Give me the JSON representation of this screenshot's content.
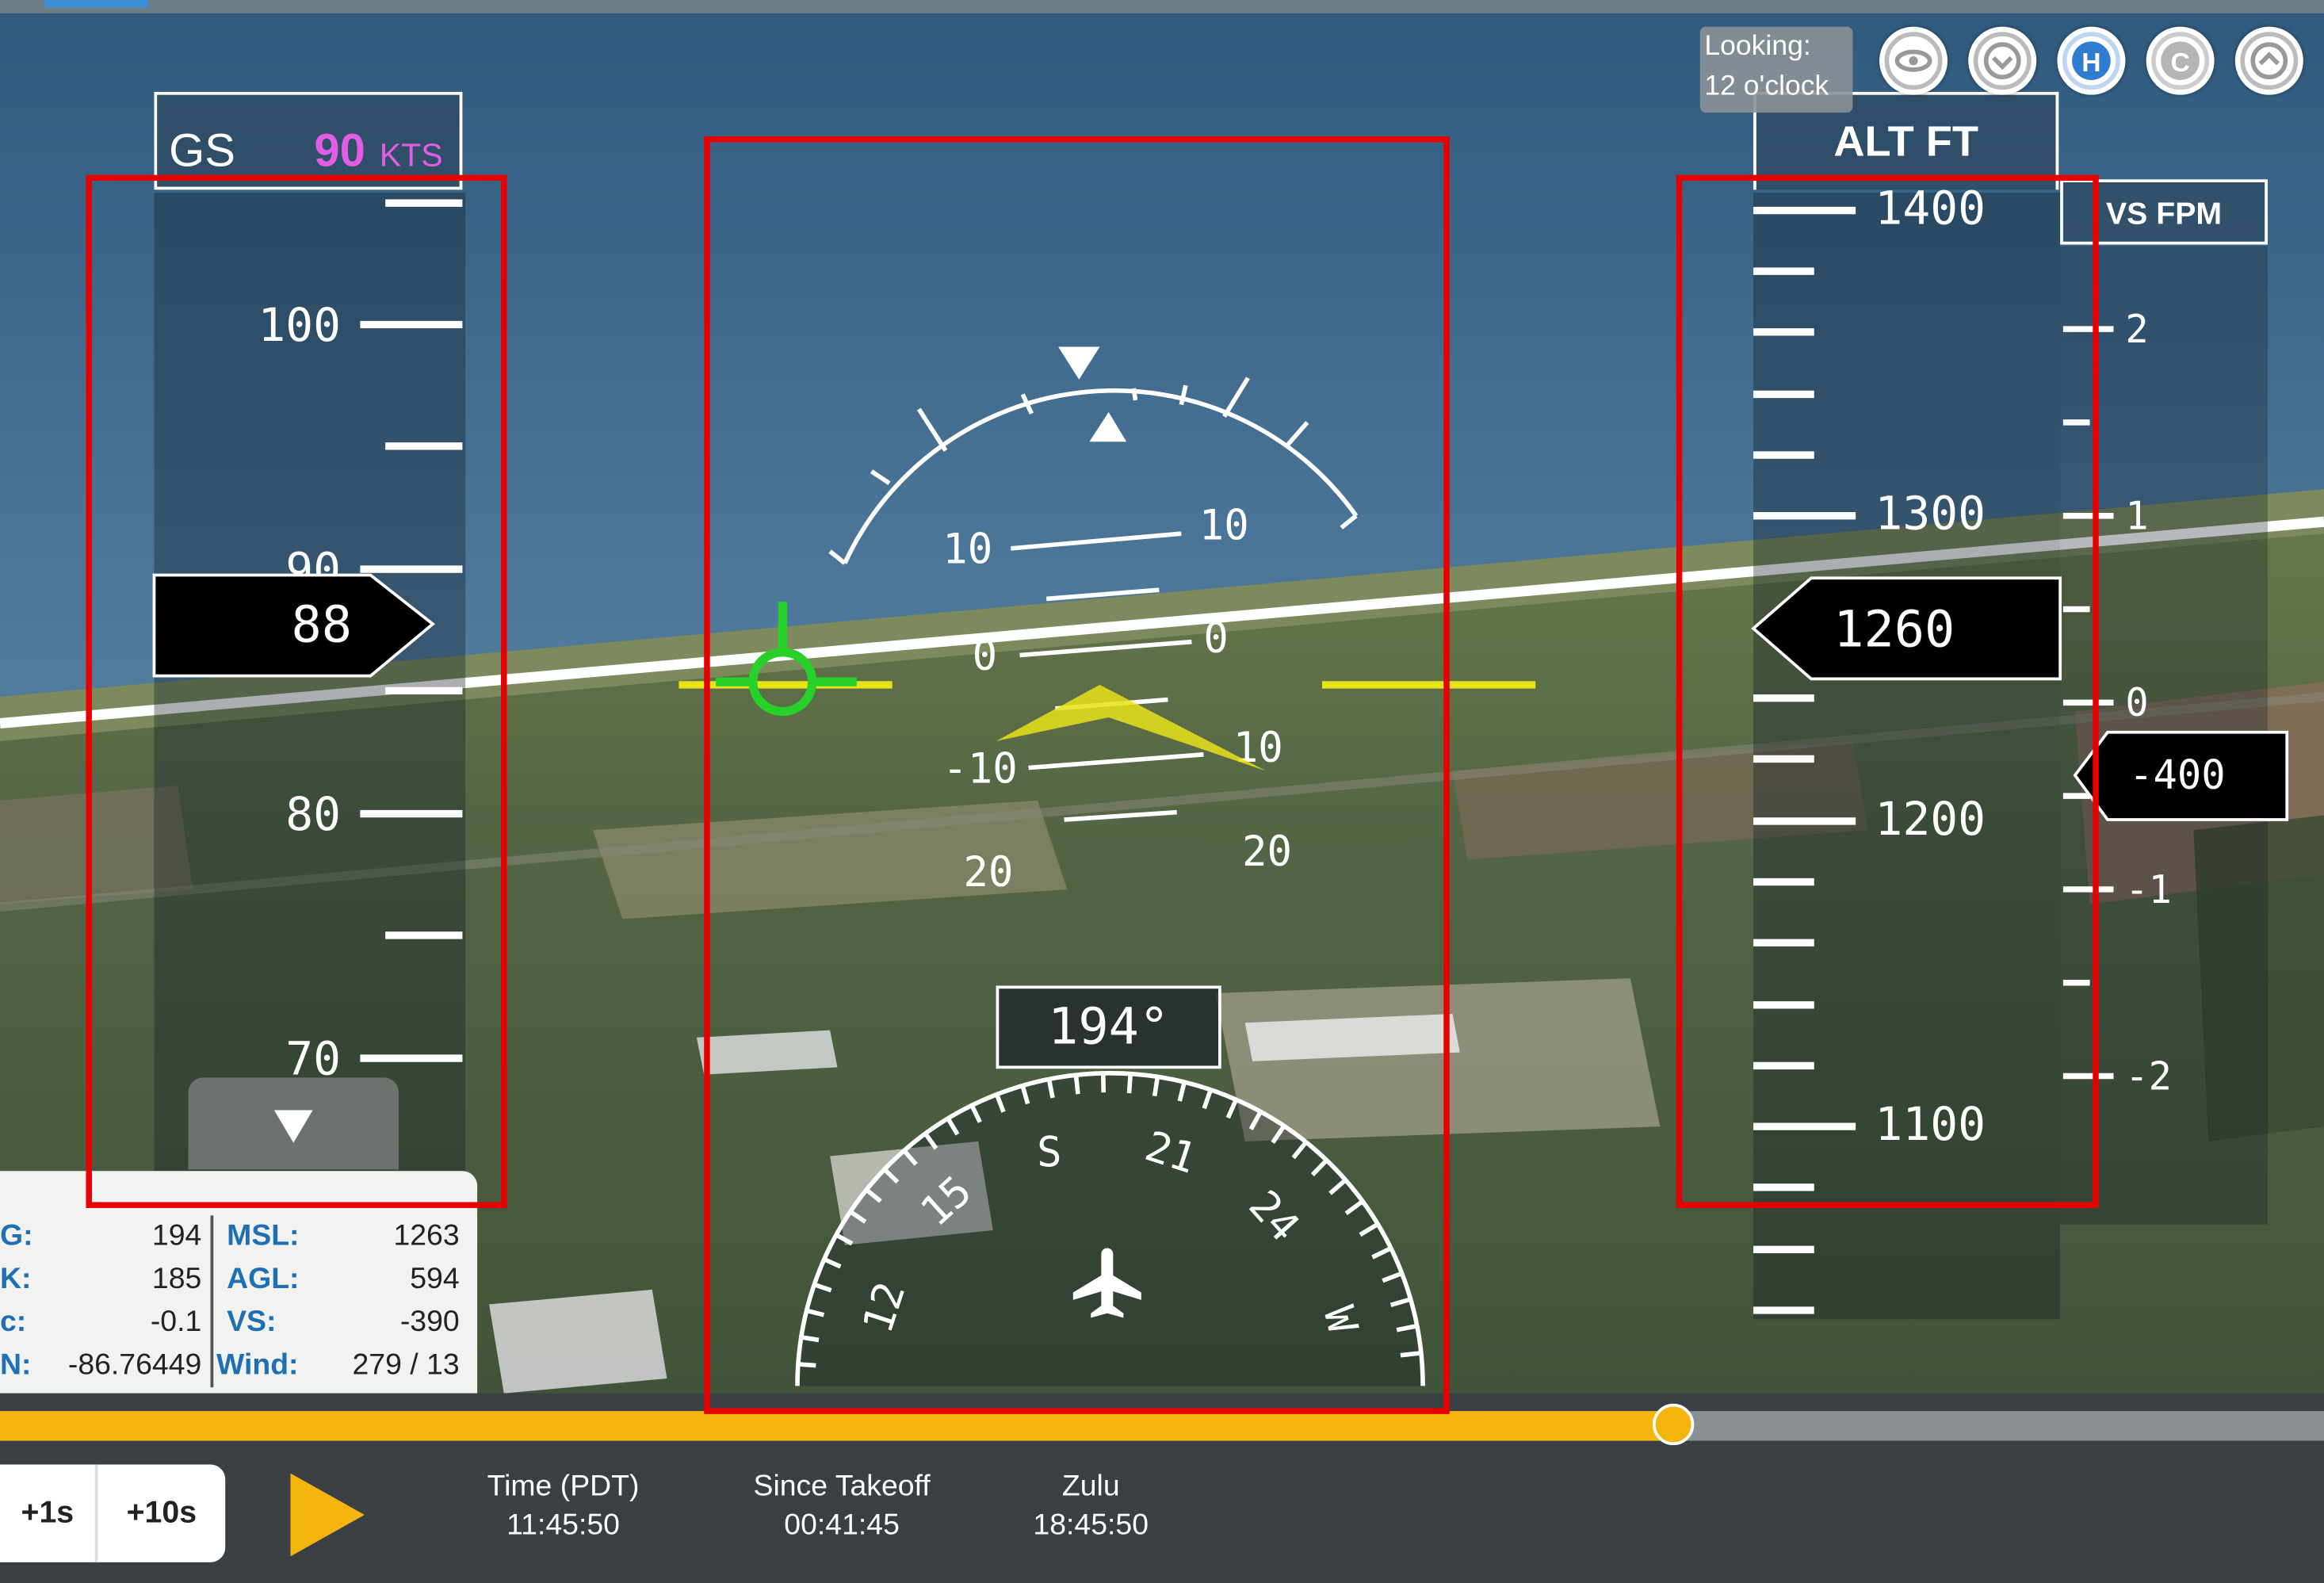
{
  "speed_tape": {
    "header_label": "GS",
    "header_value": "90",
    "header_unit": "KTS",
    "labels": [
      "100",
      "90",
      "80",
      "70"
    ],
    "current": "88"
  },
  "altitude_tape": {
    "header": "ALT FT",
    "labels": [
      "1400",
      "1300",
      "1200",
      "1100"
    ],
    "current": "1260"
  },
  "vs_tape": {
    "header": "VS FPM",
    "labels": [
      "2",
      "1",
      "0",
      "-1",
      "-2"
    ],
    "current": "-400"
  },
  "attitude": {
    "pitch_labels": [
      "10",
      "10",
      "0",
      "0",
      "-10",
      "10",
      "20",
      "20"
    ]
  },
  "heading": {
    "readout": "194°",
    "compass_labels": [
      "S",
      "21",
      "24",
      "W",
      "15",
      "12"
    ]
  },
  "looking": {
    "line1": "Looking:",
    "line2": "12 o'clock"
  },
  "view_buttons": [
    "eye-icon",
    "chevron-down-circle-icon",
    "H",
    "C",
    "chevron-up-circle-icon"
  ],
  "info_table": {
    "rows": [
      {
        "k1": "G:",
        "v1": "194",
        "k2": "MSL:",
        "v2": "1263"
      },
      {
        "k1": "K:",
        "v1": "185",
        "k2": "AGL:",
        "v2": "594"
      },
      {
        "k1": "c:",
        "v1": "-0.1",
        "k2": "VS:",
        "v2": "-390"
      },
      {
        "k1": "N:",
        "v1": "-86.76449",
        "k2": "Wind:",
        "v2": "279 / 13"
      }
    ]
  },
  "playback": {
    "progress_fraction": 0.72,
    "btn_1s": "+1s",
    "btn_10s": "+10s",
    "time_pdt_label": "Time (PDT)",
    "time_pdt_value": "11:45:50",
    "since_takeoff_label": "Since Takeoff",
    "since_takeoff_value": "00:41:45",
    "zulu_label": "Zulu",
    "zulu_value": "18:45:50"
  },
  "colors": {
    "accent": "#f5b50f",
    "speed_header": "#e25de5",
    "highlight": "#e60000",
    "flight_path": "#27d12a",
    "attitude_marker": "#e8e21a",
    "info_key": "#1f6fb2"
  }
}
